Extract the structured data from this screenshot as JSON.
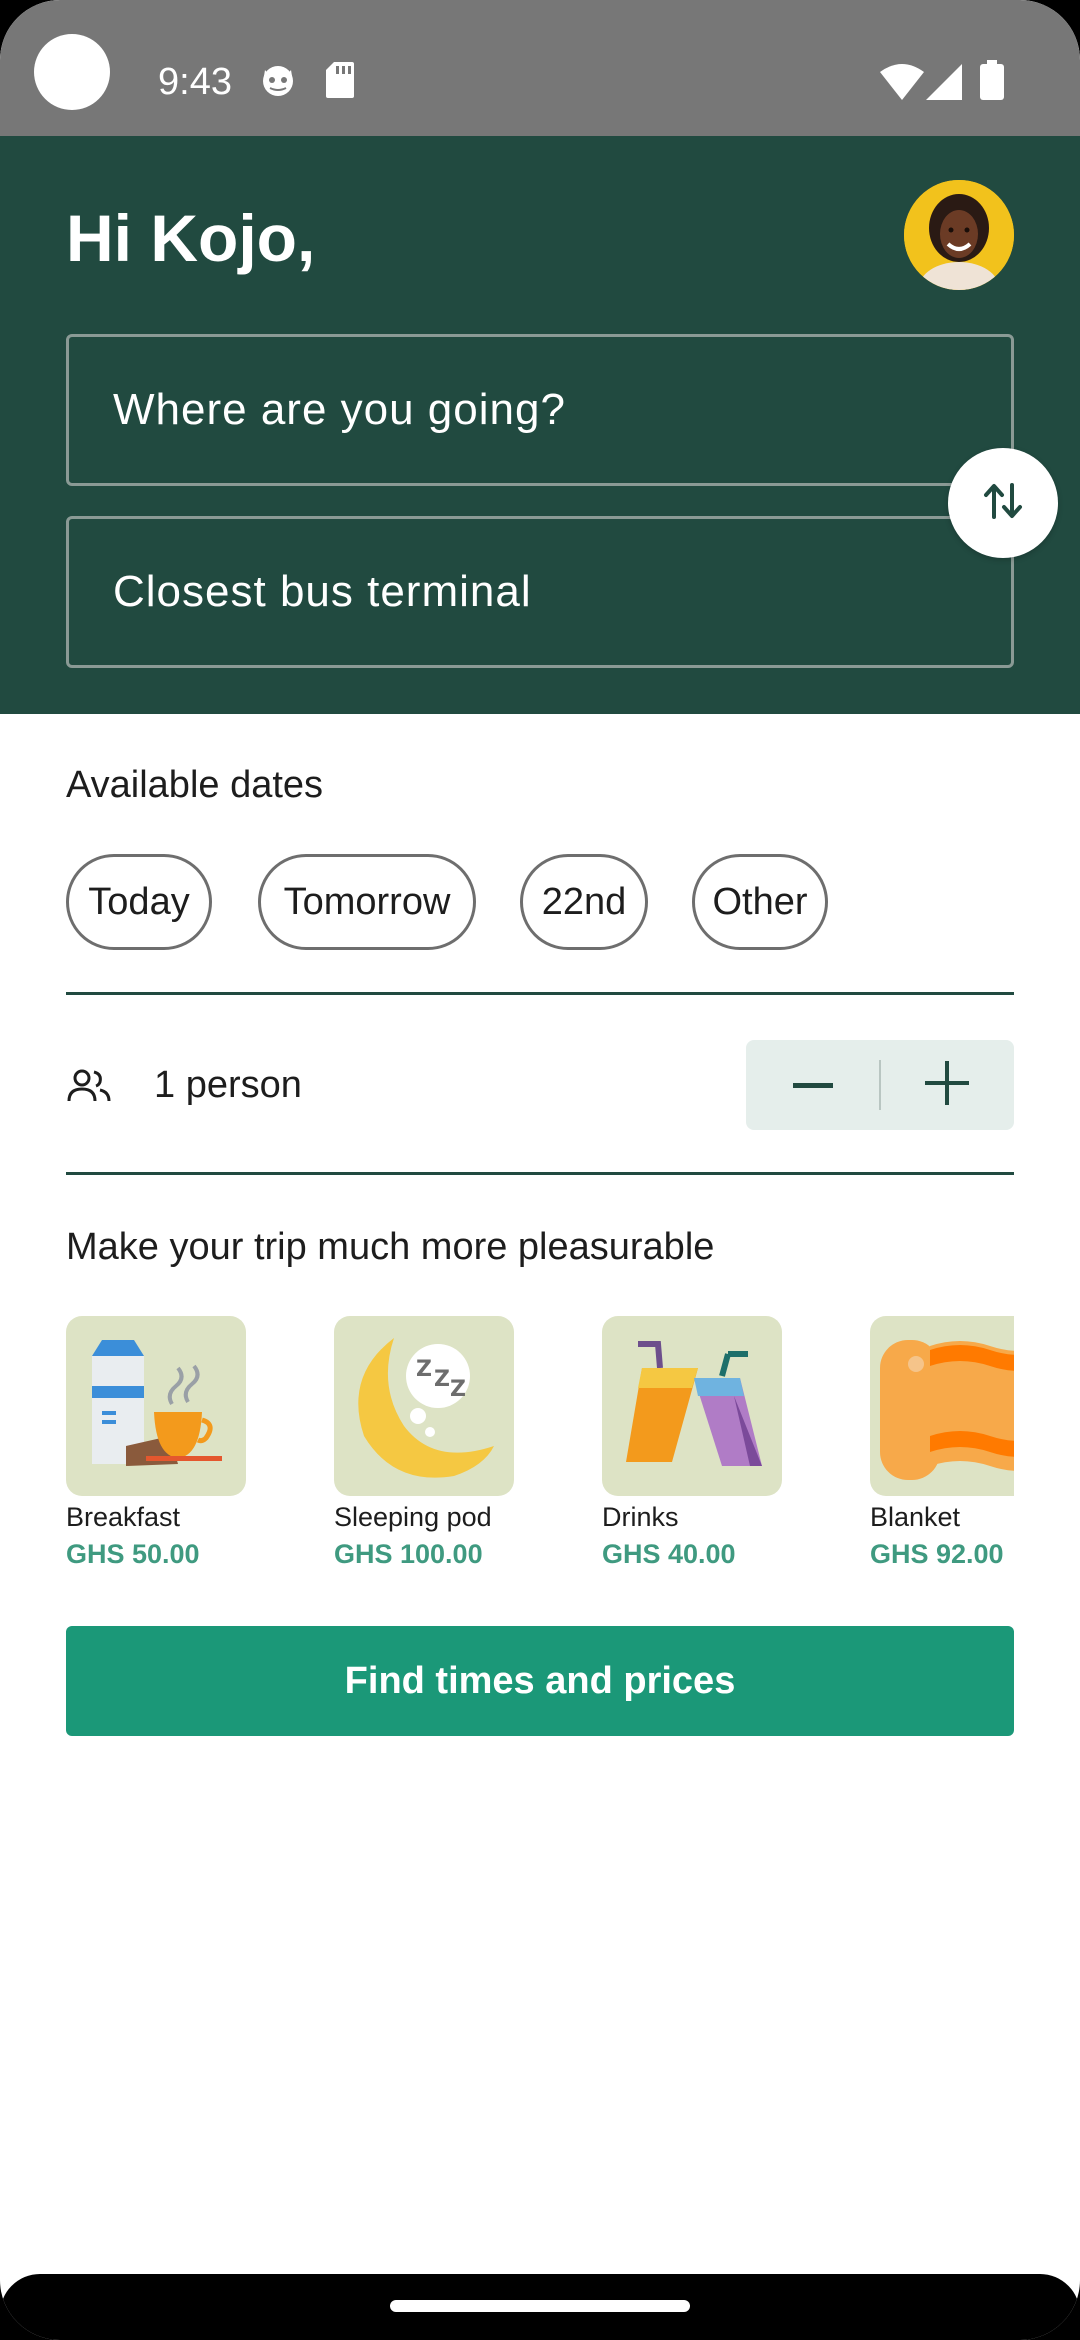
{
  "status_bar": {
    "time": "9:43",
    "icons": [
      "cat-icon",
      "sd-card-icon",
      "wifi-icon",
      "signal-icon",
      "battery-icon"
    ]
  },
  "header": {
    "greeting": "Hi Kojo,",
    "destination_field": "Where are you going?",
    "origin_field": "Closest bus terminal",
    "swap_icon": "swap-vertical-icon"
  },
  "dates": {
    "title": "Available dates",
    "options": [
      "Today",
      "Tomorrow",
      "22nd",
      "Other"
    ]
  },
  "passengers": {
    "label": "1 person",
    "icon": "people-icon"
  },
  "extras": {
    "title": "Make your trip much more pleasurable",
    "items": [
      {
        "name": "Breakfast",
        "price": "GHS 50.00"
      },
      {
        "name": "Sleeping pod",
        "price": "GHS 100.00"
      },
      {
        "name": "Drinks",
        "price": "GHS 40.00"
      },
      {
        "name": "Blanket",
        "price": "GHS 92.00"
      }
    ]
  },
  "cta": {
    "label": "Find times and prices"
  },
  "colors": {
    "header_bg": "#214a40",
    "accent": "#1b9878",
    "price": "#3f9a80"
  }
}
